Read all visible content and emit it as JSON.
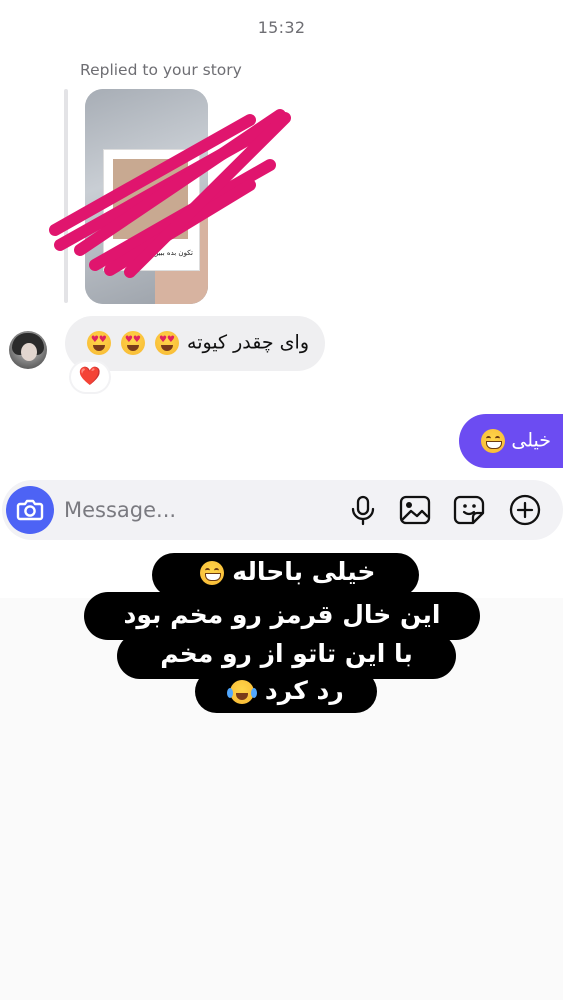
{
  "header": {
    "timestamp": "15:32"
  },
  "story_reply": {
    "label": "Replied to your story",
    "thumbnail_caption": "تکون بده ببین",
    "thumbnail_subtext": "02:49"
  },
  "messages": [
    {
      "sender": "other",
      "text": "وای چقدر کیوته",
      "emojis": [
        "heart-eyes",
        "heart-eyes",
        "heart-eyes"
      ],
      "reaction": "❤️"
    },
    {
      "sender": "me",
      "text": "خیلی",
      "emojis": [
        "grinning"
      ]
    }
  ],
  "composer": {
    "placeholder": "Message...",
    "icons": [
      "camera-icon",
      "microphone-icon",
      "image-icon",
      "sticker-icon",
      "plus-icon"
    ]
  },
  "overlay_caption": {
    "lines": [
      "خیلی باحاله",
      "این خال قرمز رو مخم بود",
      "با این تاتو از رو مخم",
      "رد کرد"
    ],
    "emojis": [
      "grinning",
      "tears-of-joy"
    ]
  },
  "colors": {
    "accent": "#6c4cf2",
    "camera_button": "#4d63f5",
    "scribble": "#e0156e",
    "incoming_bubble": "#efeff1"
  }
}
